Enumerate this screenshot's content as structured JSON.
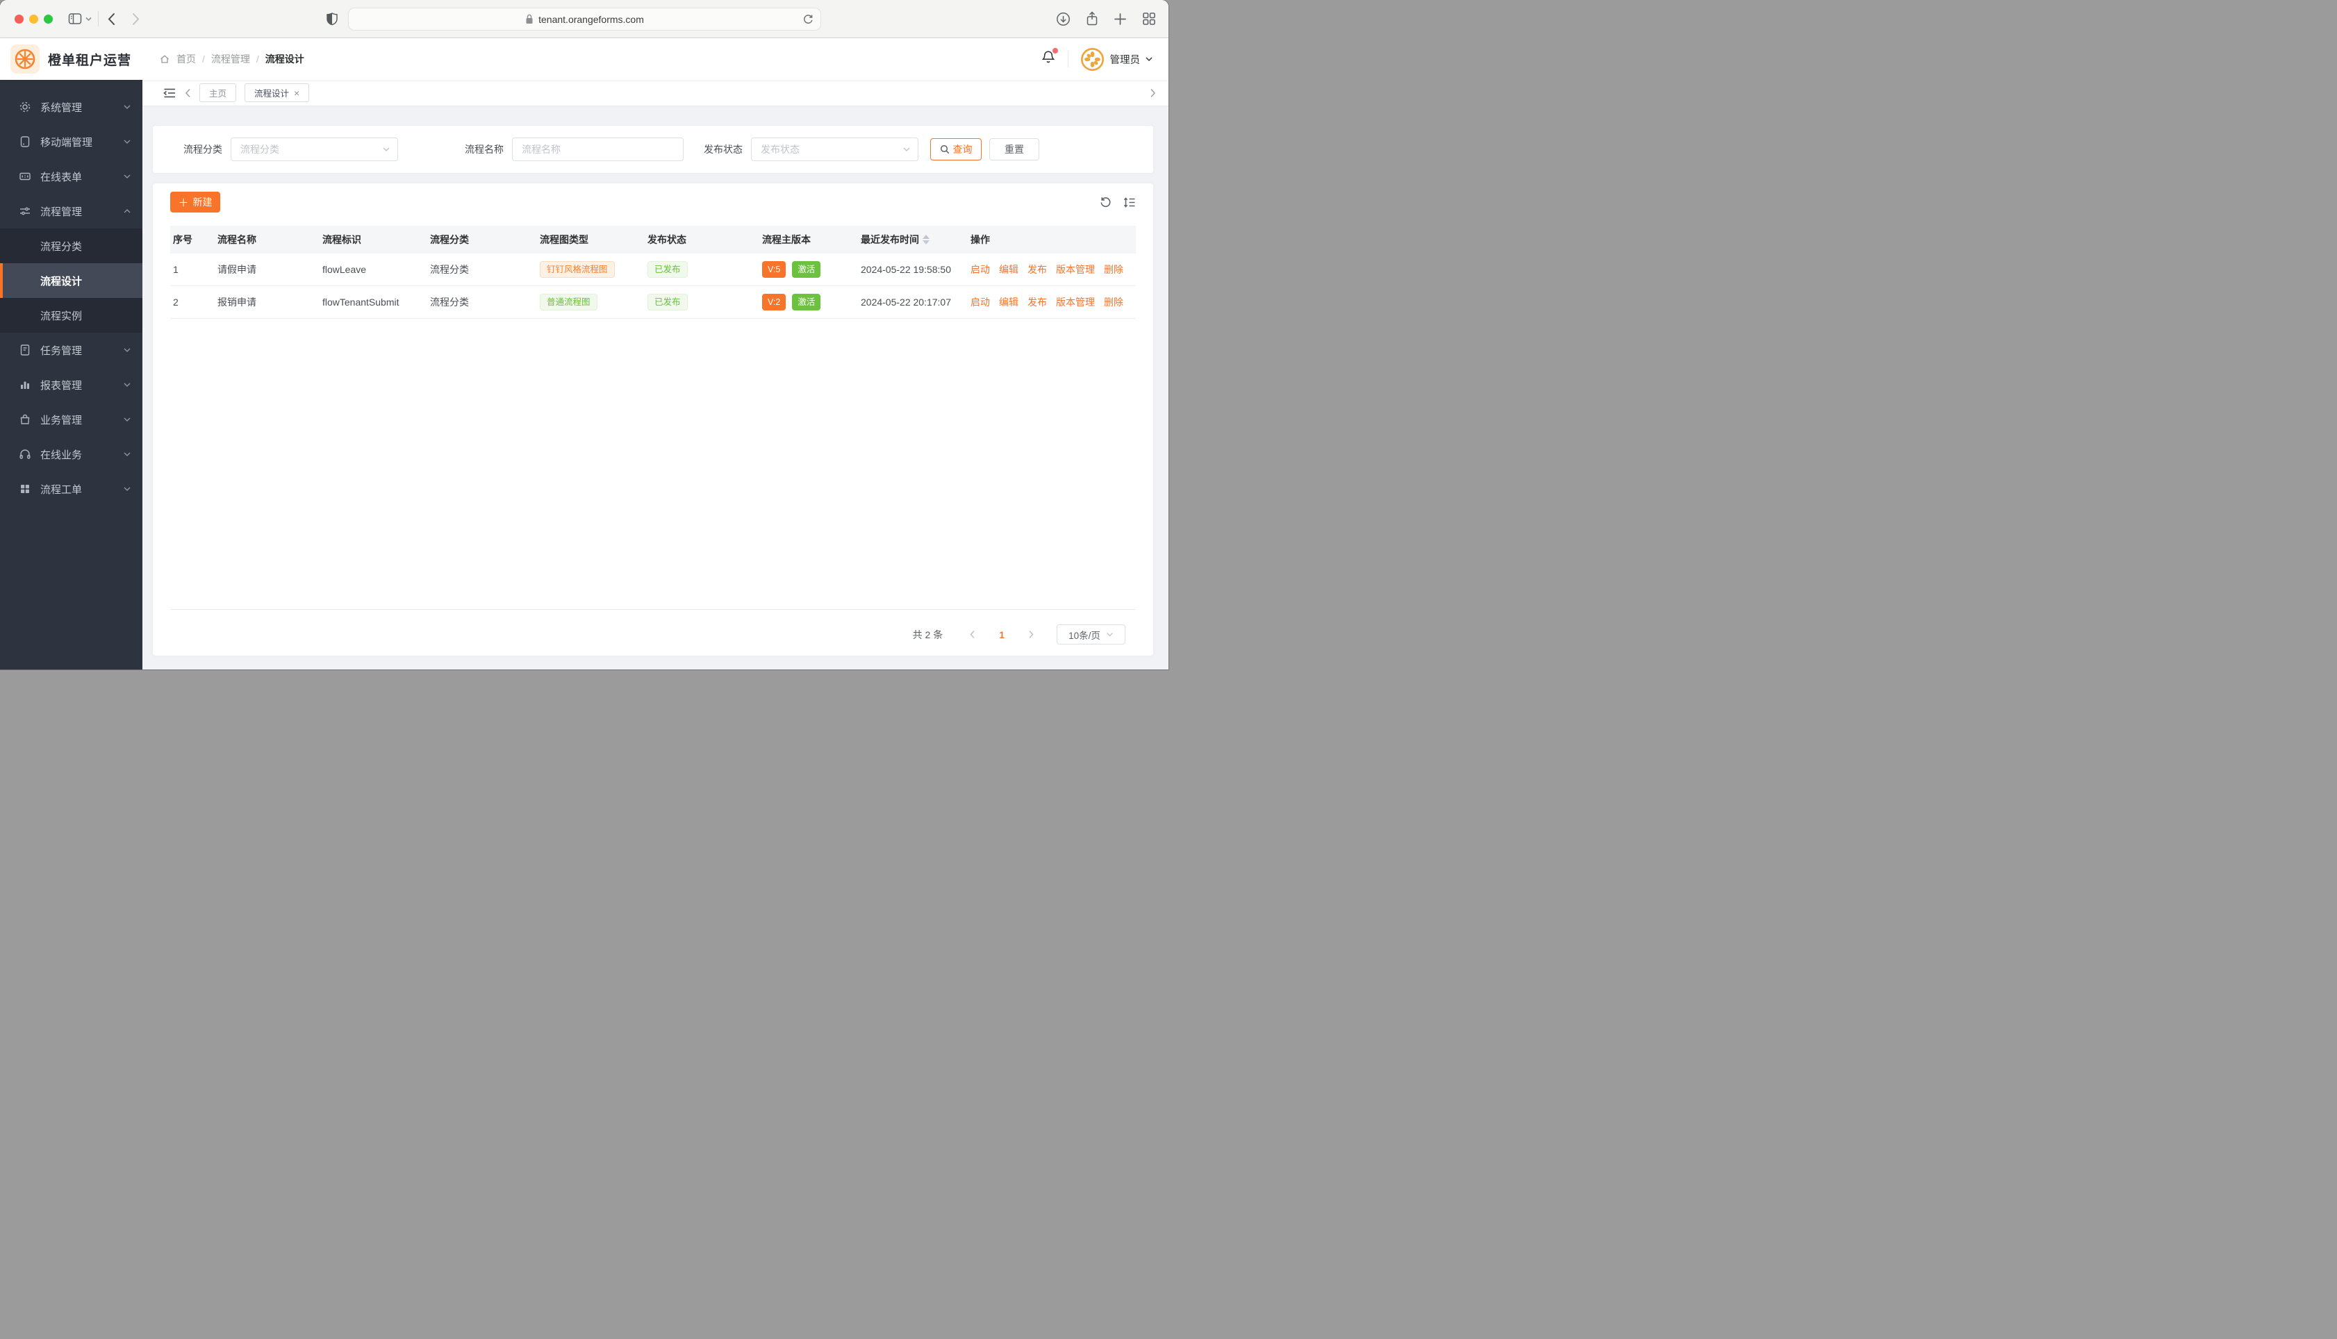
{
  "browser": {
    "url": "tenant.orangeforms.com"
  },
  "header": {
    "title": "橙单租户运营",
    "breadcrumb": [
      "首页",
      "流程管理",
      "流程设计"
    ],
    "user": "管理员"
  },
  "sidebar": {
    "items": [
      {
        "label": "系统管理"
      },
      {
        "label": "移动端管理"
      },
      {
        "label": "在线表单"
      },
      {
        "label": "流程管理",
        "expanded": true,
        "children": [
          "流程分类",
          "流程设计",
          "流程实例"
        ],
        "active_child": "流程设计"
      },
      {
        "label": "任务管理"
      },
      {
        "label": "报表管理"
      },
      {
        "label": "业务管理"
      },
      {
        "label": "在线业务"
      },
      {
        "label": "流程工单"
      }
    ]
  },
  "tabs": {
    "items": [
      {
        "label": "主页",
        "active": false
      },
      {
        "label": "流程设计",
        "active": true,
        "closable": true
      }
    ]
  },
  "filters": {
    "category_label": "流程分类",
    "category_placeholder": "流程分类",
    "name_label": "流程名称",
    "name_placeholder": "流程名称",
    "status_label": "发布状态",
    "status_placeholder": "发布状态",
    "search_label": "查询",
    "reset_label": "重置"
  },
  "toolbar": {
    "create_label": "新建"
  },
  "table": {
    "columns": [
      "序号",
      "流程名称",
      "流程标识",
      "流程分类",
      "流程图类型",
      "发布状态",
      "流程主版本",
      "最近发布时间",
      "操作"
    ],
    "rows": [
      {
        "index": "1",
        "name": "请假申请",
        "key": "flowLeave",
        "category": "流程分类",
        "diagram_type": "钉钉风格流程图",
        "diagram_color": "orange",
        "publish_status": "已发布",
        "version": "V:5",
        "version_state": "激活",
        "published_at": "2024-05-22 19:58:50",
        "actions": [
          "启动",
          "编辑",
          "发布",
          "版本管理",
          "删除"
        ]
      },
      {
        "index": "2",
        "name": "报销申请",
        "key": "flowTenantSubmit",
        "category": "流程分类",
        "diagram_type": "普通流程图",
        "diagram_color": "green",
        "publish_status": "已发布",
        "version": "V:2",
        "version_state": "激活",
        "published_at": "2024-05-22 20:17:07",
        "actions": [
          "启动",
          "编辑",
          "发布",
          "版本管理",
          "删除"
        ]
      }
    ]
  },
  "pagination": {
    "total": "共 2 条",
    "page": "1",
    "page_size": "10条/页"
  },
  "icons": {
    "close": "×",
    "plus": "＋",
    "breadcrumb_sep": "/"
  },
  "colors": {
    "accent": "#f8742a",
    "success": "#67c23a"
  }
}
